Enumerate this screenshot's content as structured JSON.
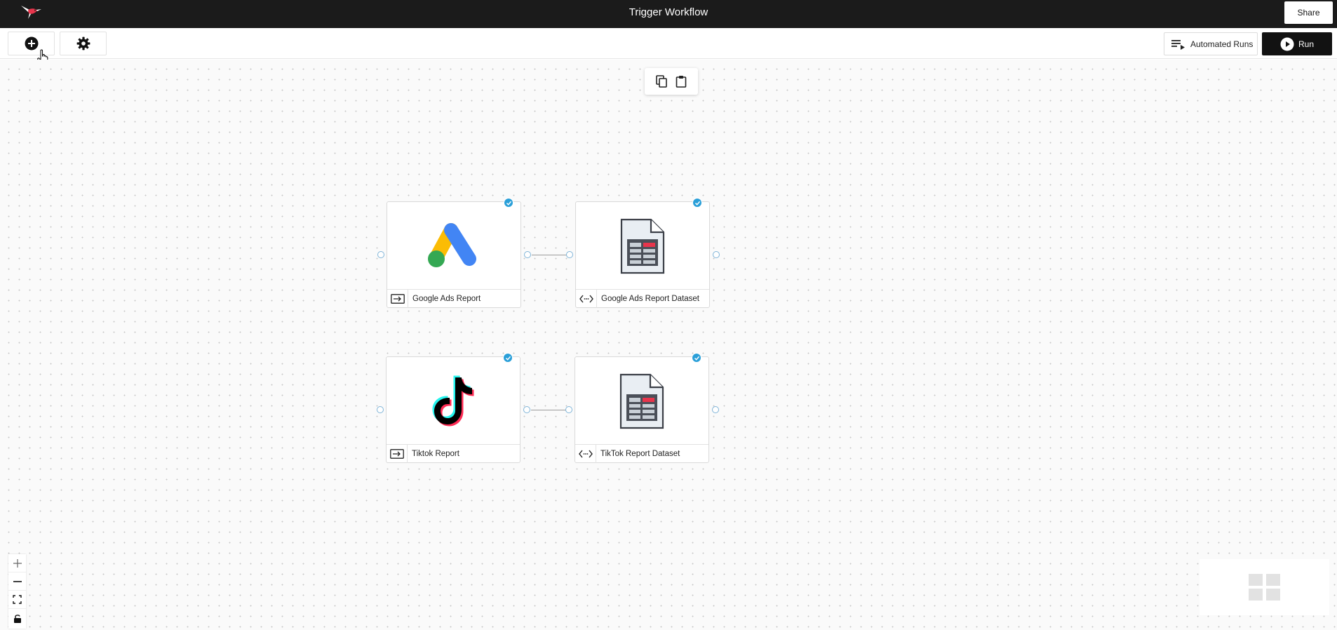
{
  "header": {
    "title": "Trigger Workflow",
    "share_label": "Share"
  },
  "toolbar": {
    "automated_runs_label": "Automated Runs",
    "run_label": "Run"
  },
  "nodes": [
    {
      "label": "Google Ads Report",
      "icon": "google-ads-logo",
      "type_icon": "input-icon"
    },
    {
      "label": "Google Ads Report Dataset",
      "icon": "dataset-file-icon",
      "type_icon": "code-icon"
    },
    {
      "label": "Tiktok Report",
      "icon": "tiktok-logo",
      "type_icon": "input-icon"
    },
    {
      "label": "TikTok Report Dataset",
      "icon": "dataset-file-icon",
      "type_icon": "code-icon"
    }
  ],
  "colors": {
    "header_bg": "#1b1b1b",
    "run_bg": "#121212",
    "check_blue": "#2a9fd8",
    "canvas_bg": "#fafafa"
  }
}
